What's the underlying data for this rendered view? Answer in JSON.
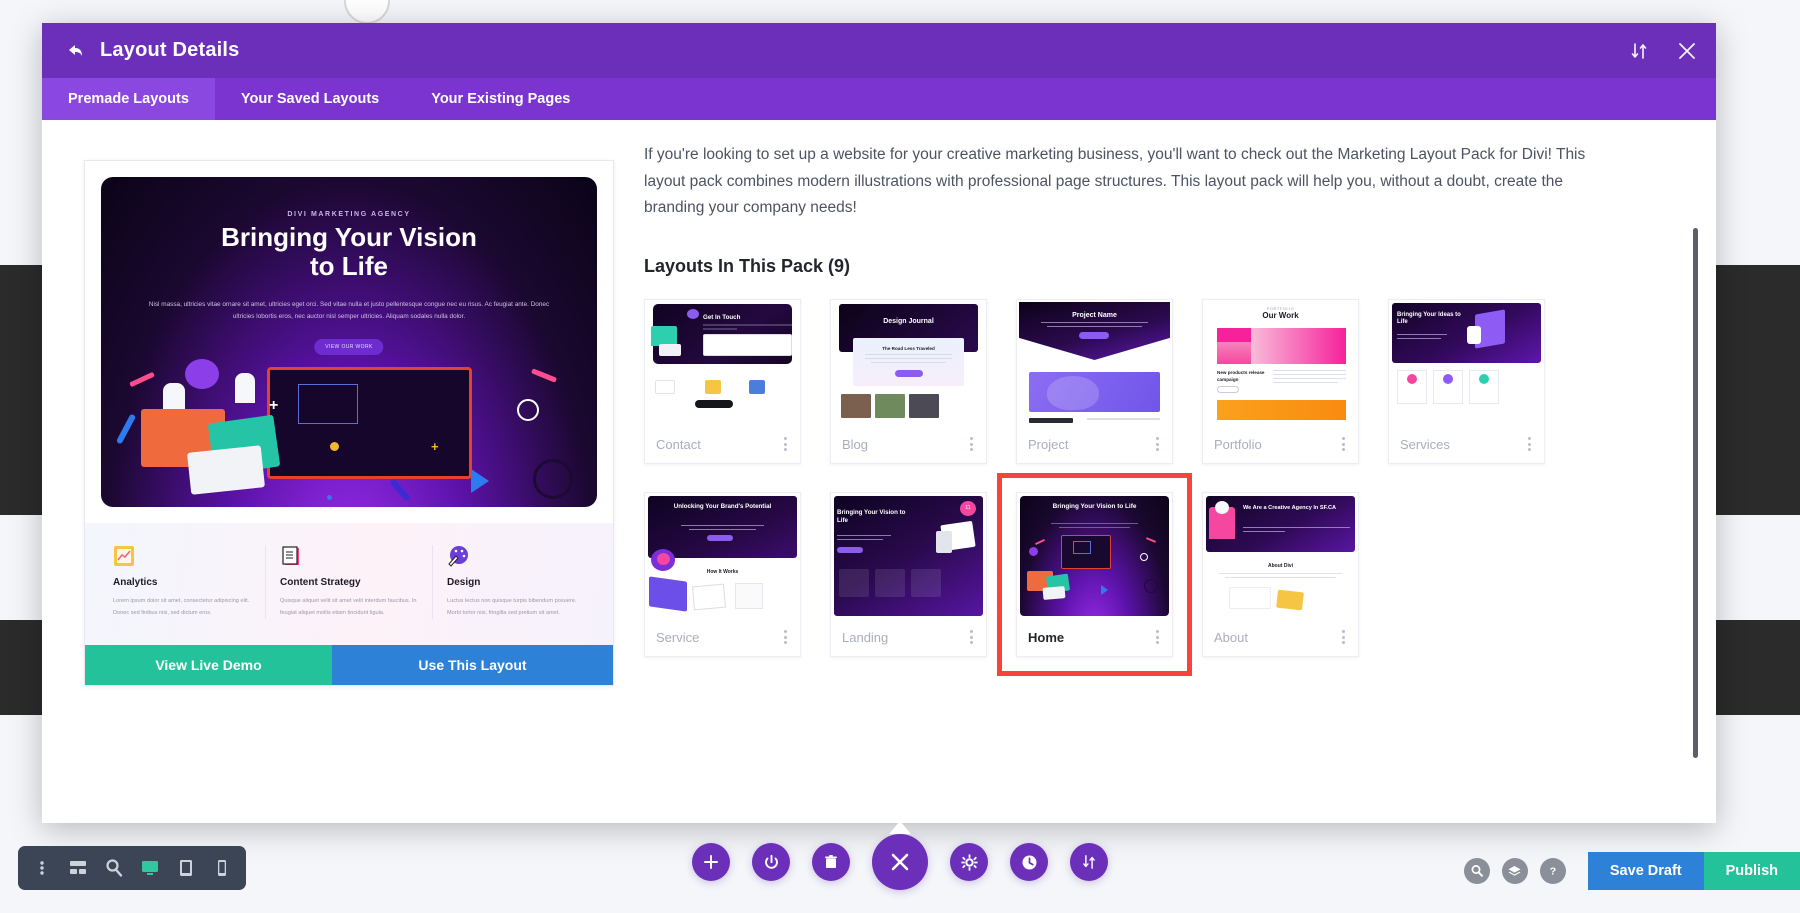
{
  "window": {
    "title": "Layout Details",
    "back_icon": "back-arrow-icon",
    "sort_icon": "sort-updown-icon",
    "close_icon": "close-x-icon"
  },
  "tabs": [
    {
      "label": "Premade Layouts",
      "active": true
    },
    {
      "label": "Your Saved Layouts",
      "active": false
    },
    {
      "label": "Your Existing Pages",
      "active": false
    }
  ],
  "preview": {
    "hero": {
      "kicker": "DIVI MARKETING AGENCY",
      "title_line1": "Bringing Your Vision",
      "title_line2": "to Life",
      "paragraph": "Nisl massa, ultricies vitae ornare sit amet, ultricies eget orci. Sed vitae nulla et justo pellentesque congue nec eu risus. Ac feugiat ante. Donec ultricies lobortis eros, nec auctor nisl semper ultricies. Aliquam sodales nulla dolor.",
      "button": "VIEW OUR WORK"
    },
    "features": [
      {
        "icon": "chart-icon",
        "title": "Analytics",
        "text": "Lorem ipsum dolor sit amet, consectetur adipiscing elit. Donec sed finibus nisi, sed dictum eros."
      },
      {
        "icon": "clipboard-icon",
        "title": "Content Strategy",
        "text": "Quisque aliquet velit sit amet velit interdum faucibus. In feugiat aliquet mollis etiam tincidunt ligula."
      },
      {
        "icon": "palette-icon",
        "title": "Design",
        "text": "Luctus lectus non quisque turpis bibendum posuere. Morbi tortor nisi, fringilla sed pretium sit amet."
      }
    ],
    "actions": {
      "demo": "View Live Demo",
      "use": "Use This Layout"
    }
  },
  "detail": {
    "description": "If you're looking to set up a website for your creative marketing business, you'll want to check out the Marketing Layout Pack for Divi! This layout pack combines modern illustrations with professional page structures. This layout pack will help you, without a doubt, create the branding your company needs!",
    "pack_heading": "Layouts In This Pack (9)",
    "layouts": [
      {
        "name": "Contact",
        "selected": false,
        "thumb_title": "Get In Touch",
        "style": "contact"
      },
      {
        "name": "Blog",
        "selected": false,
        "thumb_title": "Design Journal",
        "thumb_sub": "The Road Less Traveled",
        "style": "blog"
      },
      {
        "name": "Project",
        "selected": false,
        "thumb_title": "Project Name",
        "style": "project"
      },
      {
        "name": "Portfolio",
        "selected": false,
        "thumb_title": "Our Work",
        "thumb_sub": "New products release campaign",
        "style": "portfolio"
      },
      {
        "name": "Services",
        "selected": false,
        "thumb_title": "Bringing Your Ideas to Life",
        "style": "services"
      },
      {
        "name": "Service",
        "selected": false,
        "thumb_title": "Unlocking Your Brand's Potential",
        "thumb_sub": "How It Works",
        "style": "service"
      },
      {
        "name": "Landing",
        "selected": false,
        "thumb_title": "Bringing Your Vision to Life",
        "style": "landing"
      },
      {
        "name": "Home",
        "selected": true,
        "thumb_title": "Bringing Your Vision to Life",
        "style": "home"
      },
      {
        "name": "About",
        "selected": false,
        "thumb_title": "We Are a Creative Agency In SF.CA",
        "thumb_sub": "About Divi",
        "style": "about"
      }
    ],
    "kebab_icon": "kebab-menu-icon"
  },
  "left_toolbar": [
    {
      "icon": "kebab-menu-icon",
      "name": "more-options",
      "active": false
    },
    {
      "icon": "wireframe-icon",
      "name": "wireframe-view",
      "active": false
    },
    {
      "icon": "zoom-out-icon",
      "name": "zoom-view",
      "active": false
    },
    {
      "icon": "desktop-icon",
      "name": "desktop-view",
      "active": true
    },
    {
      "icon": "tablet-icon",
      "name": "tablet-view",
      "active": false
    },
    {
      "icon": "phone-icon",
      "name": "phone-view",
      "active": false
    }
  ],
  "center_toolbar": [
    {
      "icon": "plus-icon",
      "name": "add-section"
    },
    {
      "icon": "power-icon",
      "name": "toggle-builder"
    },
    {
      "icon": "trash-icon",
      "name": "delete"
    },
    {
      "icon": "close-x-icon",
      "name": "close-menu",
      "big": true
    },
    {
      "icon": "gear-icon",
      "name": "settings"
    },
    {
      "icon": "history-icon",
      "name": "editing-history"
    },
    {
      "icon": "sort-updown-icon",
      "name": "layers-order"
    }
  ],
  "right_toolbar": {
    "icons": [
      {
        "icon": "search-icon",
        "name": "search-button"
      },
      {
        "icon": "layers-icon",
        "name": "layers-button"
      },
      {
        "icon": "help-icon",
        "name": "help-button"
      }
    ],
    "save_label": "Save Draft",
    "publish_label": "Publish"
  },
  "colors": {
    "purple": "#6b2fba",
    "tab_purple": "#7b34cf",
    "green": "#23c29a",
    "blue": "#2d82d8",
    "selection_red": "#f9423a"
  }
}
